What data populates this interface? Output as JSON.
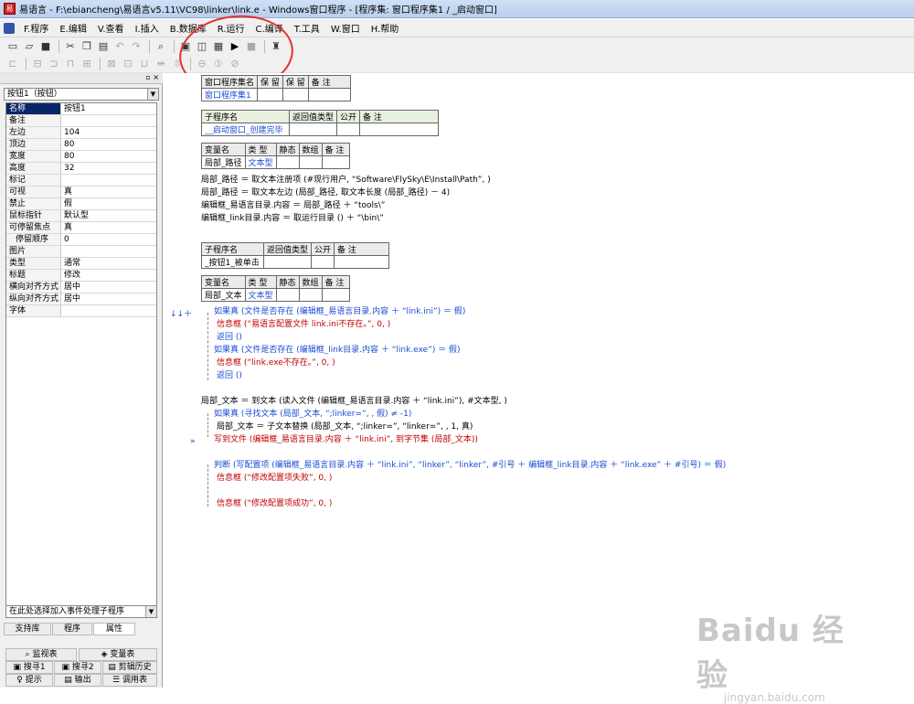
{
  "window": {
    "title": "易语言 - F:\\ebiancheng\\易语言v5.11\\VC98\\linker\\link.e - Windows窗口程序 - [程序集: 窗口程序集1 / _启动窗口]"
  },
  "menu": [
    "F.程序",
    "E.编辑",
    "V.查看",
    "I.插入",
    "B.数据库",
    "R.运行",
    "C.编译",
    "T.工具",
    "W.窗口",
    "H.帮助"
  ],
  "left": {
    "object_selector": "按钮1（按钮）",
    "properties": [
      {
        "name": "名称",
        "value": "按钮1"
      },
      {
        "name": "备注",
        "value": ""
      },
      {
        "name": "左边",
        "value": "104"
      },
      {
        "name": "顶边",
        "value": "80"
      },
      {
        "name": "宽度",
        "value": "80"
      },
      {
        "name": "高度",
        "value": "32"
      },
      {
        "name": "标记",
        "value": ""
      },
      {
        "name": "可视",
        "value": "真"
      },
      {
        "name": "禁止",
        "value": "假"
      },
      {
        "name": "鼠标指针",
        "value": "默认型"
      },
      {
        "name": "可停留焦点",
        "value": "真"
      },
      {
        "name": "停留顺序",
        "value": "0"
      },
      {
        "name": "图片",
        "value": ""
      },
      {
        "name": "类型",
        "value": "通常"
      },
      {
        "name": "标题",
        "value": "修改"
      },
      {
        "name": "横向对齐方式",
        "value": "居中"
      },
      {
        "name": "纵向对齐方式",
        "value": "居中"
      },
      {
        "name": "字体",
        "value": ""
      }
    ],
    "event_selector": "在此处选择加入事件处理子程序",
    "tabs": [
      "支持库",
      "程序",
      "属性"
    ],
    "bottom_tabs_row1": [
      "监视表",
      "变量表"
    ],
    "bottom_tabs_row2": [
      "搜寻1",
      "搜寻2",
      "剪辑历史"
    ],
    "bottom_tabs_row3": [
      "提示",
      "输出",
      "调用表"
    ]
  },
  "code": {
    "assembly_table": {
      "headers": [
        "窗口程序集名",
        "保 留",
        "保 留",
        "备 注"
      ],
      "row": [
        "窗口程序集1",
        "",
        "",
        ""
      ]
    },
    "sub1_table": {
      "headers": [
        "子程序名",
        "返回值类型",
        "公开",
        "备 注"
      ],
      "row": [
        "__启动窗口_创建完毕",
        "",
        "",
        ""
      ]
    },
    "var1_table": {
      "headers": [
        "变量名",
        "类 型",
        "静态",
        "数组",
        "备 注"
      ],
      "row": [
        "局部_路径",
        "文本型",
        "",
        "",
        ""
      ]
    },
    "sub1_lines": [
      "局部_路径 ＝ 取文本注册项 (#现行用户, “Software\\FlySky\\E\\Install\\Path”, )",
      "局部_路径 ＝ 取文本左边 (局部_路径, 取文本长度 (局部_路径) － 4)",
      "编辑框_易语言目录.内容 ＝ 局部_路径 ＋ “tools\\”",
      "编辑框_link目录.内容 ＝ 取运行目录 () ＋ “\\bin\\”"
    ],
    "sub2_table": {
      "headers": [
        "子程序名",
        "返回值类型",
        "公开",
        "备 注"
      ],
      "row": [
        "_按钮1_被单击",
        "",
        "",
        ""
      ]
    },
    "var2_table": {
      "headers": [
        "变量名",
        "类 型",
        "静态",
        "数组",
        "备 注"
      ],
      "row": [
        "局部_文本",
        "文本型",
        "",
        "",
        ""
      ]
    },
    "sub2_lines": [
      "如果真 (文件是否存在 (编辑框_易语言目录.内容 ＋ “link.ini”) ＝ 假)",
      "信息框 (“易语言配置文件 link.ini不存在。”, 0, )",
      "返回 ()",
      "如果真 (文件是否存在 (编辑框_link目录.内容 ＋ “link.exe”) ＝ 假)",
      "信息框 (“link.exe不存在。”, 0, )",
      "返回 ()",
      "局部_文本 ＝ 到文本 (读入文件 (编辑框_易语言目录.内容 ＋ “link.ini”), #文本型, )",
      "如果真 (寻找文本 (局部_文本, “;linker=”, , 假) ≠ -1)",
      "局部_文本 ＝ 子文本替换 (局部_文本, “;linker=”, “linker=”, , 1, 真)",
      "写到文件 (编辑框_易语言目录.内容 ＋ “link.ini”, 到字节集 (局部_文本))",
      "判断 (写配置项 (编辑框_易语言目录.内容 ＋ “link.ini”, “linker”, “linker”, #引号 ＋ 编辑框_link目录.内容 ＋ “link.exe” ＋ #引号) ＝ 假)",
      "信息框 (“修改配置项失败”, 0, )",
      "信息框 (“修改配置项成功”, 0, )"
    ],
    "gutter_marks": [
      "↓↓＋",
      "»"
    ]
  },
  "watermark": {
    "brand": "Baidu 经验",
    "url": "jingyan.baidu.com"
  },
  "colors": {
    "keyword": "#c00000",
    "type": "#1a4bd6",
    "annotation": "#e53030"
  }
}
